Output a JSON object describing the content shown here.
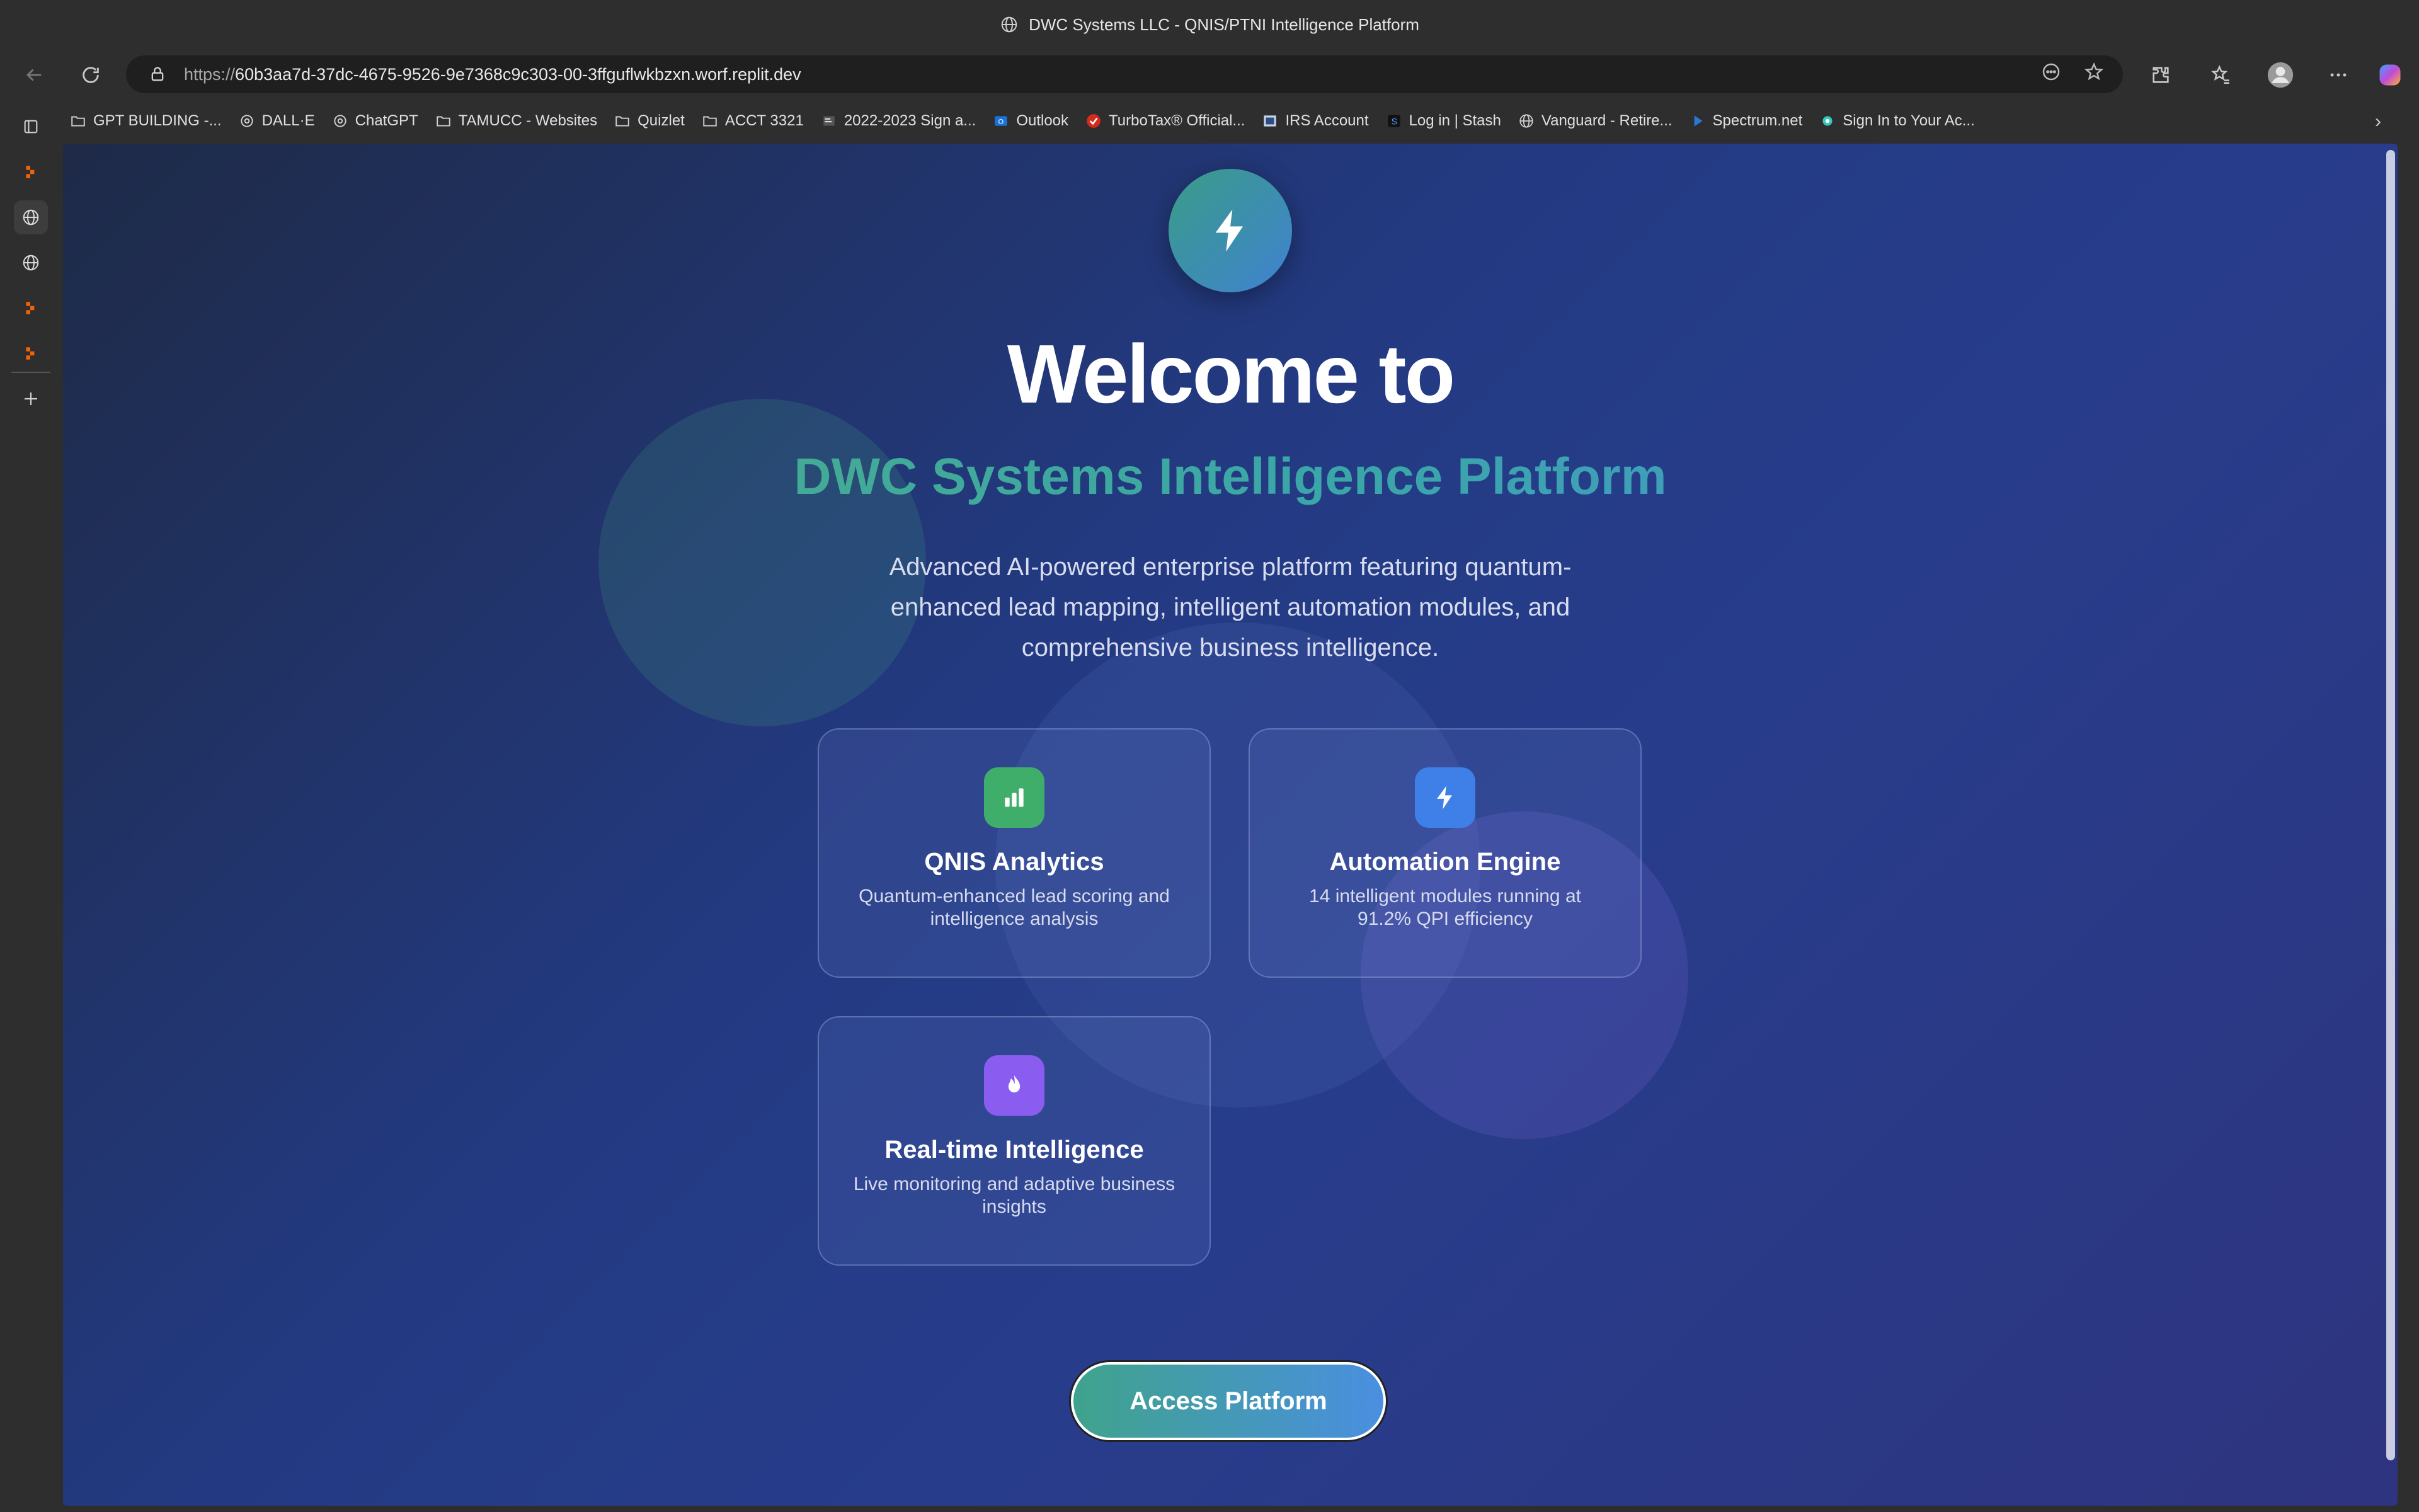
{
  "window": {
    "title": "DWC Systems LLC - QNIS/PTNI Intelligence Platform"
  },
  "address_bar": {
    "url_proto": "https://",
    "url_host": "60b3aa7d-37dc-4675-9526-9e7368c9c303-00-3ffguflwkbzxn.worf.replit.dev"
  },
  "bookmarks": [
    {
      "label": "GPT BUILDING -...",
      "icon": "folder-icon"
    },
    {
      "label": "DALL·E",
      "icon": "openai-icon"
    },
    {
      "label": "ChatGPT",
      "icon": "openai-icon"
    },
    {
      "label": "TAMUCC - Websites",
      "icon": "folder-icon"
    },
    {
      "label": "Quizlet",
      "icon": "folder-icon"
    },
    {
      "label": "ACCT 3321",
      "icon": "folder-icon"
    },
    {
      "label": "2022-2023 Sign a...",
      "icon": "doc-icon"
    },
    {
      "label": "Outlook",
      "icon": "outlook-icon"
    },
    {
      "label": "TurboTax® Official...",
      "icon": "turbotax-icon"
    },
    {
      "label": "IRS Account",
      "icon": "irs-icon"
    },
    {
      "label": "Log in | Stash",
      "icon": "stash-icon"
    },
    {
      "label": "Vanguard - Retire...",
      "icon": "globe-icon"
    },
    {
      "label": "Spectrum.net",
      "icon": "play-icon"
    },
    {
      "label": "Sign In to Your Ac...",
      "icon": "spark-icon"
    }
  ],
  "hero": {
    "welcome": "Welcome to",
    "platform": "DWC Systems Intelligence Platform",
    "description": "Advanced AI-powered enterprise platform featuring quantum-enhanced lead mapping, intelligent automation modules, and comprehensive business intelligence."
  },
  "features": [
    {
      "title": "QNIS Analytics",
      "description": "Quantum-enhanced lead scoring and intelligence analysis",
      "icon": "chart-icon",
      "color": "#3fae6a"
    },
    {
      "title": "Automation Engine",
      "description": "14 intelligent modules running at 91.2% QPI efficiency",
      "icon": "bolt-icon",
      "color": "#3f7fe8"
    },
    {
      "title": "Real-time Intelligence",
      "description": "Live monitoring and adaptive business insights",
      "icon": "flame-icon",
      "color": "#8b5cf0"
    }
  ],
  "cta": {
    "label": "Access Platform"
  }
}
